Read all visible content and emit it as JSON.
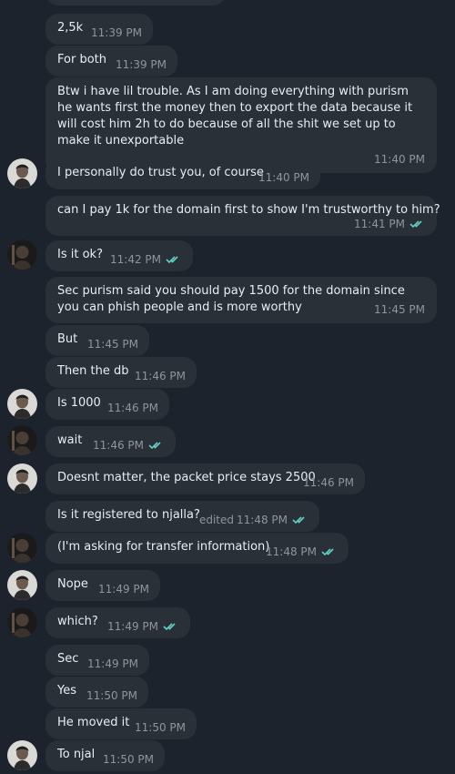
{
  "colors": {
    "background": "#1c232c",
    "bubble": "#2a3038",
    "meta_text": "#8d959d",
    "read_check": "#5fd0c4"
  },
  "messages": [
    {
      "text": "2,5k",
      "time": "11:39 PM"
    },
    {
      "text": "For both",
      "time": "11:39 PM"
    },
    {
      "text": "Btw i have lil trouble. As I am doing everything with purism he wants first the money then to export the data because it will cost him 2h to do because of all the shit we set up to make it unexportable",
      "time": "11:40 PM"
    },
    {
      "text": "I personally do trust you, of course",
      "time": "11:40 PM",
      "avatar": "avatar-man-light-background"
    },
    {
      "text": "can I pay 1k for the domain first to show I'm trustworthy to him?",
      "time": "11:41 PM",
      "read": true
    },
    {
      "text": "Is it ok?",
      "time": "11:42 PM",
      "read": true,
      "avatar": "avatar-dark"
    },
    {
      "text": "Sec purism said you should pay 1500 for the domain since you can phish people and is more worthy",
      "time": "11:45 PM"
    },
    {
      "text": "But",
      "time": "11:45 PM"
    },
    {
      "text": "Then the db",
      "time": "11:46 PM"
    },
    {
      "text": "Is 1000",
      "time": "11:46 PM",
      "avatar": "avatar-man-light-background"
    },
    {
      "text": "wait",
      "time": "11:46 PM",
      "read": true,
      "avatar": "avatar-dark"
    },
    {
      "text": "Doesnt matter, the packet price stays 2500",
      "time": "11:46 PM",
      "avatar": "avatar-man-light-background"
    },
    {
      "text": "Is it registered to njalla?",
      "time": "11:48 PM",
      "edited": "edited",
      "read": true
    },
    {
      "text": "(I'm asking for transfer information)",
      "time": "11:48 PM",
      "read": true,
      "avatar": "avatar-dark"
    },
    {
      "text": "Nope",
      "time": "11:49 PM",
      "avatar": "avatar-man-light-background"
    },
    {
      "text": "which?",
      "time": "11:49 PM",
      "read": true,
      "avatar": "avatar-dark"
    },
    {
      "text": "Sec",
      "time": "11:49 PM"
    },
    {
      "text": "Yes",
      "time": "11:50 PM"
    },
    {
      "text": "He moved it",
      "time": "11:50 PM"
    },
    {
      "text": "To njal",
      "time": "11:50 PM",
      "avatar": "avatar-man-light-background"
    }
  ]
}
